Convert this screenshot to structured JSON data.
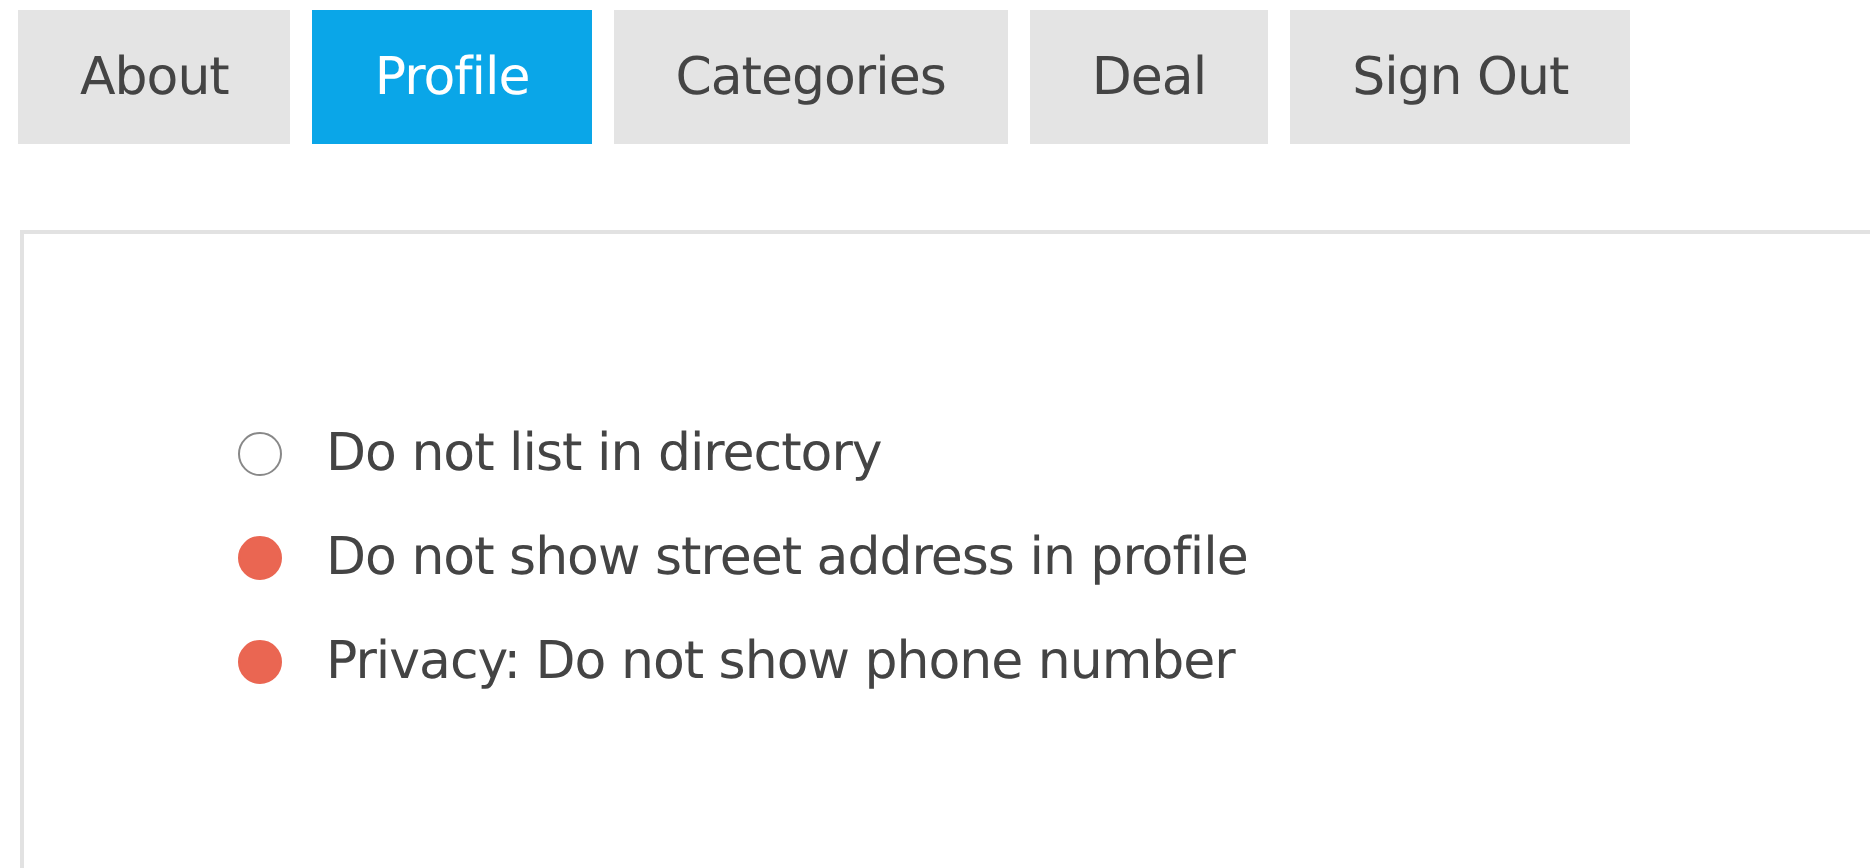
{
  "tabs": [
    {
      "label": "About",
      "selected": false
    },
    {
      "label": "Profile",
      "selected": true
    },
    {
      "label": "Categories",
      "selected": false
    },
    {
      "label": "Deal",
      "selected": false
    },
    {
      "label": "Sign Out",
      "selected": false
    }
  ],
  "options": [
    {
      "label": "Do not list in directory",
      "checked": false
    },
    {
      "label": "Do not show street address in profile",
      "checked": true
    },
    {
      "label": "Privacy: Do not show phone number",
      "checked": true
    }
  ]
}
